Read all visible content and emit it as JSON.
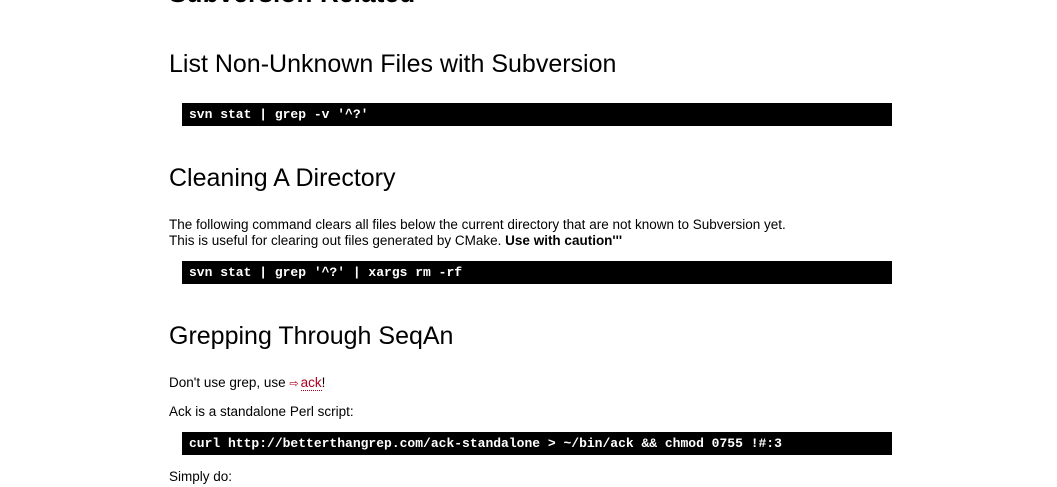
{
  "page": {
    "section_title": "Subversion Related",
    "sections": [
      {
        "heading": "List Non-Unknown Files with Subversion",
        "code": "svn stat | grep -v '^?'"
      },
      {
        "heading": "Cleaning A Directory",
        "para_line1": "The following command clears all files below the current directory that are not known to Subversion yet.",
        "para_line2": "This is useful for clearing out files generated by CMake. ",
        "para_bold": "Use with caution'''",
        "code": "svn stat | grep '^?' | xargs rm -rf"
      },
      {
        "heading": "Grepping Through SeqAn",
        "para1_prefix": "Don't use grep, use ",
        "link_icon": "⇨",
        "link_text": "ack",
        "para1_suffix": "!",
        "para2": "Ack is a standalone Perl script:",
        "code": "curl http://betterthangrep.com/ack-standalone > ~/bin/ack && chmod 0755 !#:3",
        "para3": "Simply do:"
      }
    ]
  }
}
